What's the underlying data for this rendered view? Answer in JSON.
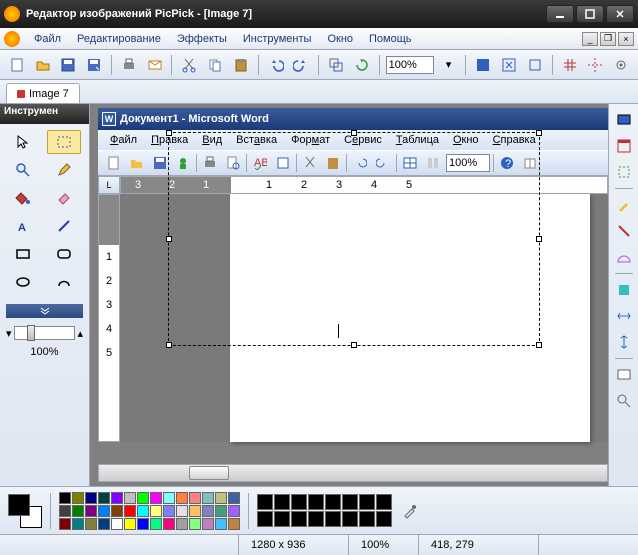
{
  "window": {
    "title": "Редактор изображений PicPick - [Image 7]"
  },
  "menubar": [
    "Файл",
    "Редактирование",
    "Эффекты",
    "Инструменты",
    "Окно",
    "Помощь"
  ],
  "toolbar": {
    "zoom": "100%"
  },
  "tabs": [
    {
      "label": "Image 7"
    }
  ],
  "tools_panel": {
    "title": "Инструмен",
    "zoom_label": "100%"
  },
  "inner": {
    "title": "Документ1 - Microsoft Word",
    "menus": [
      "Файл",
      "Правка",
      "Вид",
      "Вставка",
      "Формат",
      "Сервис",
      "Таблица",
      "Окно",
      "Справка"
    ],
    "zoom": "100%",
    "ruler_corner": "L",
    "hruler_marks": [
      "3",
      "2",
      "1",
      "1",
      "2",
      "3",
      "4",
      "5"
    ],
    "vruler_marks": [
      "1",
      "2",
      "3",
      "4",
      "5"
    ]
  },
  "palette": {
    "fg": "#000000",
    "bg": "#ffffff",
    "colors": [
      "#000000",
      "#404040",
      "#800000",
      "#808000",
      "#008000",
      "#008080",
      "#000080",
      "#800080",
      "#808040",
      "#004040",
      "#0080ff",
      "#004080",
      "#8000ff",
      "#804000",
      "#ffffff",
      "#c0c0c0",
      "#ff0000",
      "#ffff00",
      "#00ff00",
      "#00ffff",
      "#0000ff",
      "#ff00ff",
      "#ffff80",
      "#00ff80",
      "#80ffff",
      "#8080ff",
      "#ff0080",
      "#ff8040",
      "#e0e0e0",
      "#a0a0a0",
      "#ff8080",
      "#ffc060",
      "#80ff80",
      "#80c0c0",
      "#8080c0",
      "#c080c0",
      "#c0c080",
      "#40a080",
      "#40c0ff",
      "#4060a0",
      "#a060ff",
      "#c08040"
    ]
  },
  "status": {
    "dimensions": "1280 x 936",
    "zoom": "100%",
    "position": "418, 279"
  }
}
